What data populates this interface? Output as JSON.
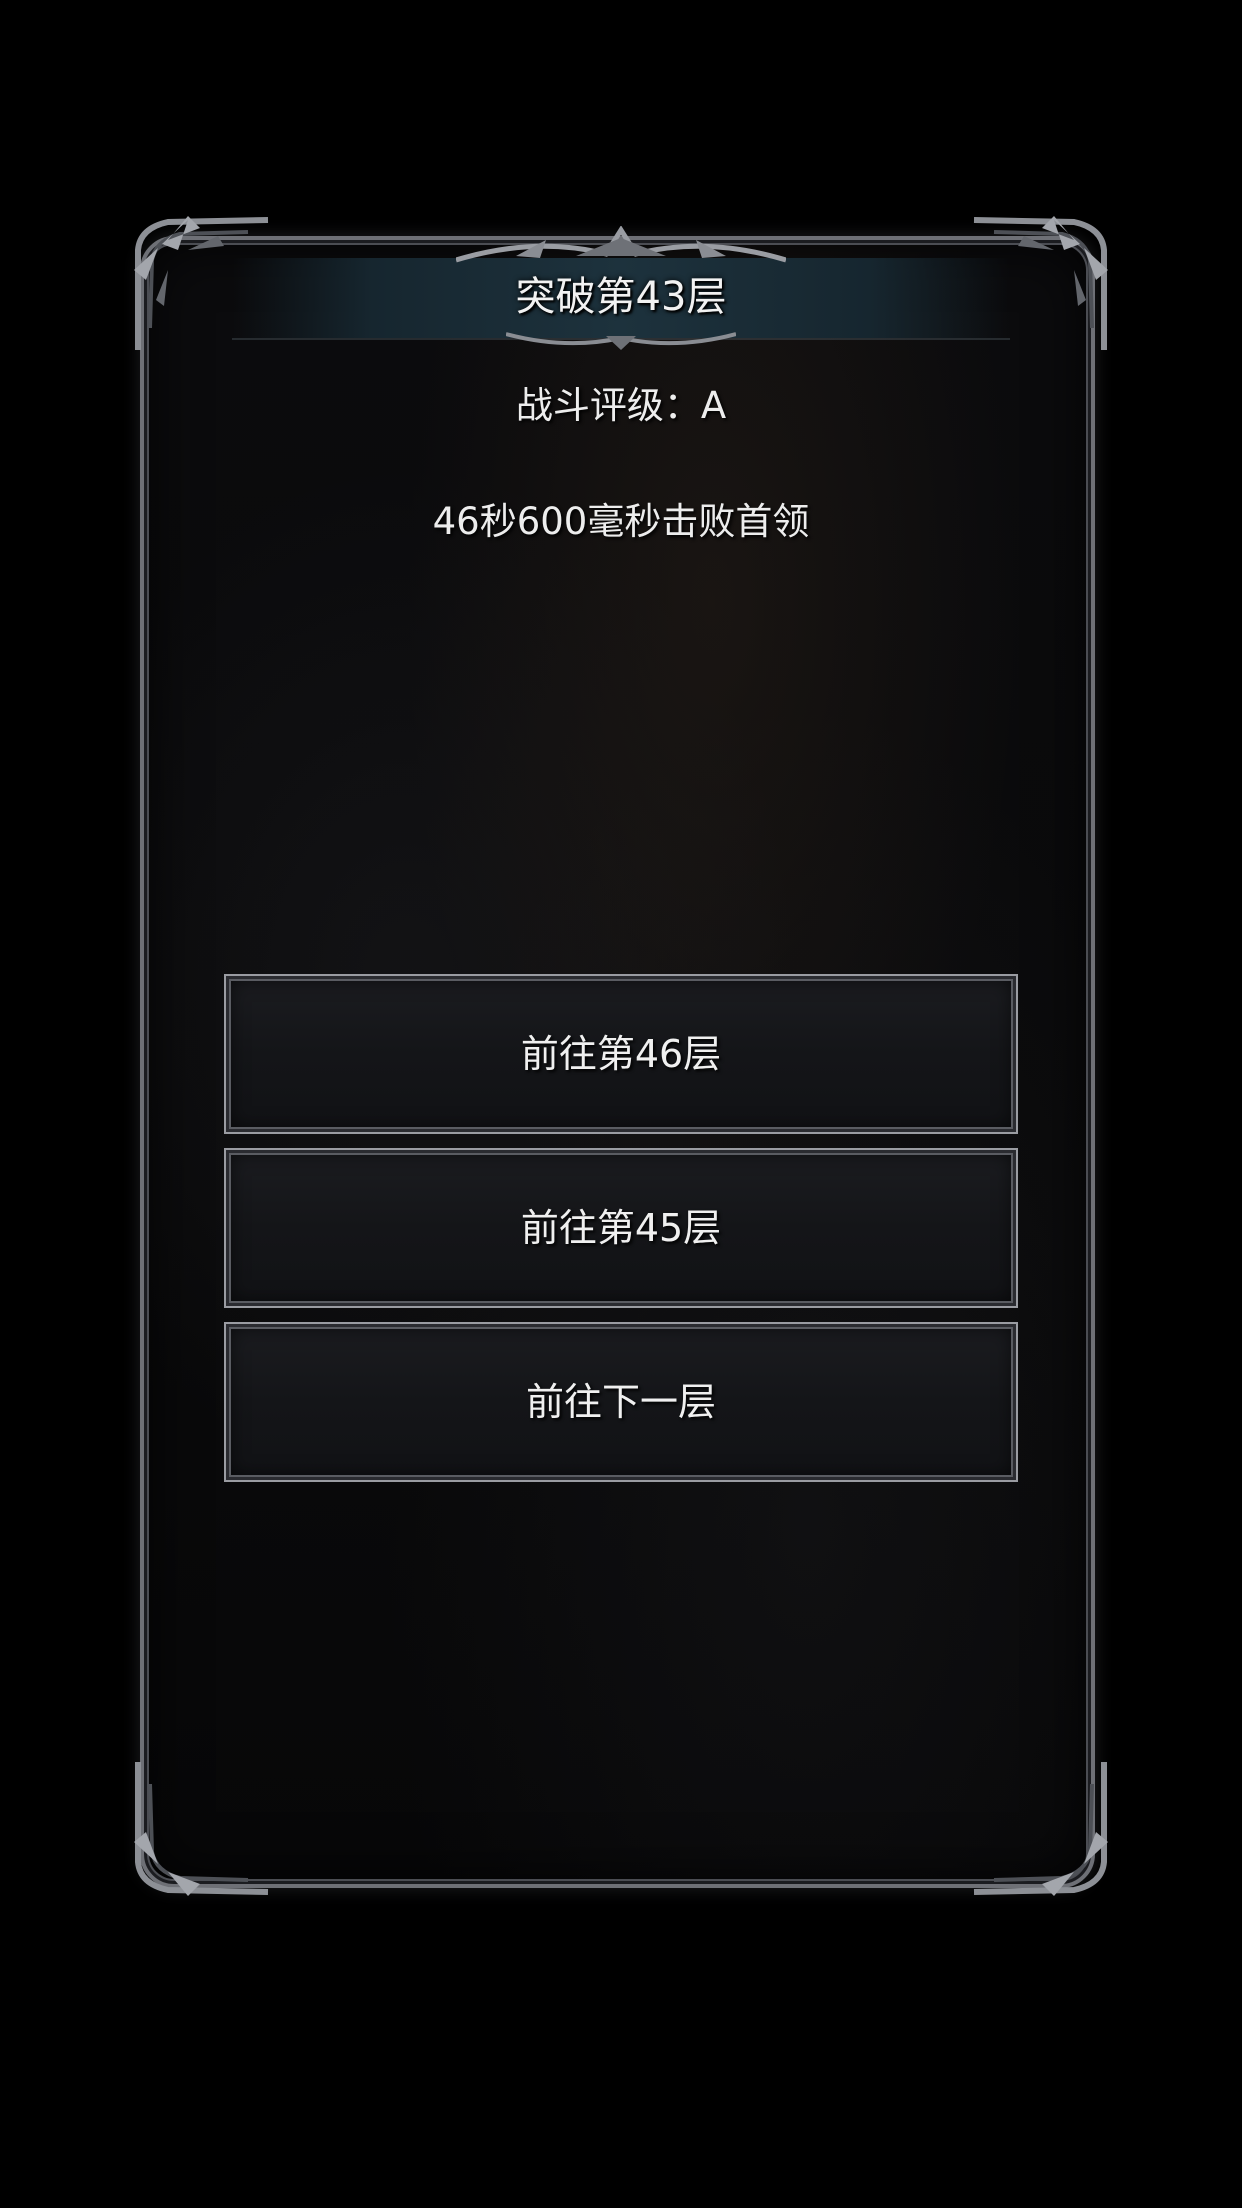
{
  "dialog": {
    "title": "突破第43层",
    "rating": "战斗评级：A",
    "clear_time": "46秒600毫秒击败首领"
  },
  "buttons": [
    {
      "label": "前往第46层"
    },
    {
      "label": "前往第45层"
    },
    {
      "label": "前往下一层"
    }
  ],
  "colors": {
    "background": "#000000",
    "panel": "#0a0a0b",
    "frame": "#6e7076",
    "title_banner": "#1d323d",
    "button": "#141518",
    "text": "#f0f0f0"
  }
}
